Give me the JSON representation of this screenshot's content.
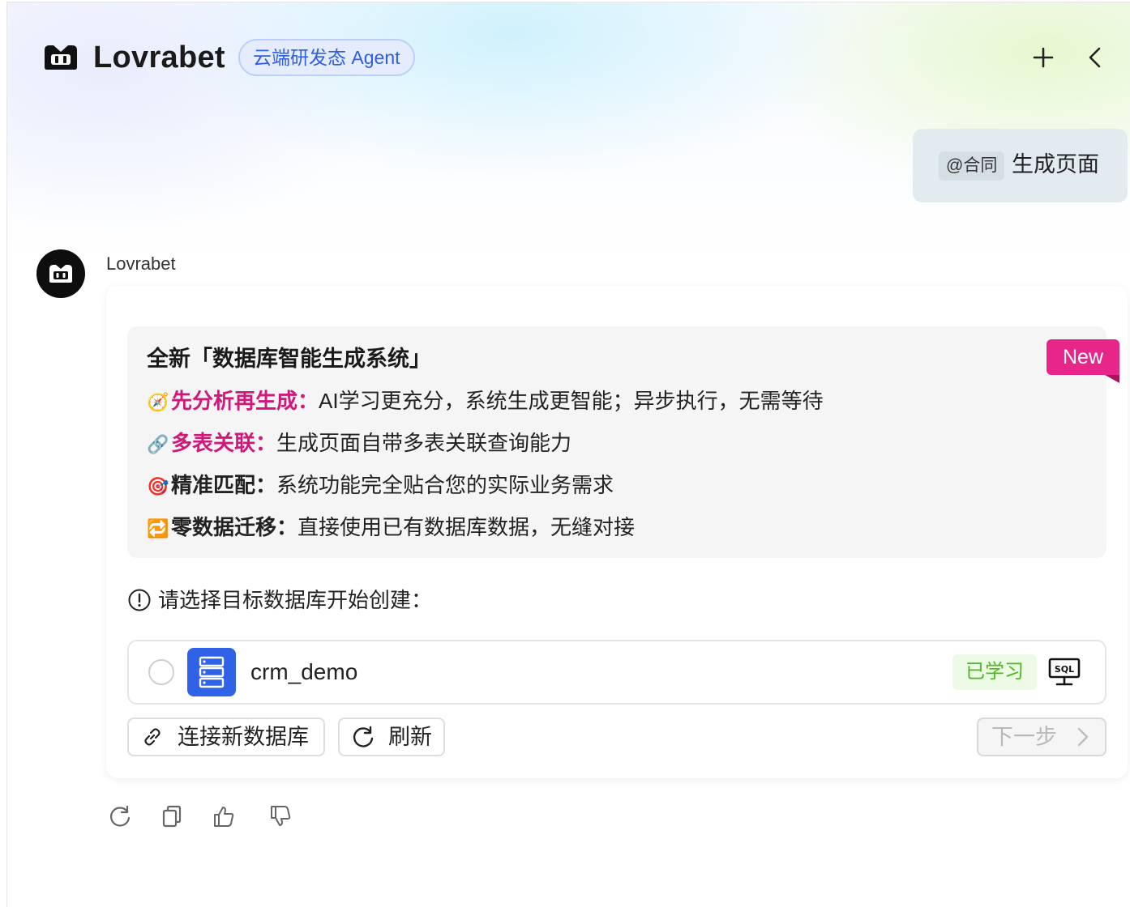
{
  "header": {
    "brand": "Lovrabet",
    "agent_pill": "云端研发态 Agent",
    "new_chat_icon": "plus-icon",
    "collapse_icon": "chevron-left-icon"
  },
  "user_message": {
    "mention": "@合同",
    "text": "生成页面"
  },
  "bot": {
    "name": "Lovrabet",
    "promo": {
      "title": "全新「数据库智能生成系统」",
      "badge": "New",
      "features": [
        {
          "emoji": "🧭",
          "key": "先分析再生成：",
          "text": "AI学习更充分，系统生成更智能；异步执行，无需等待",
          "highlight": true
        },
        {
          "emoji": "🔗",
          "key": "多表关联：",
          "text": "生成页面自带多表关联查询能力",
          "highlight": true
        },
        {
          "emoji": "🎯",
          "key": "精准匹配：",
          "text": "系统功能完全贴合您的实际业务需求",
          "highlight": false
        },
        {
          "emoji": "🔁",
          "key": "零数据迁移：",
          "text": "直接使用已有数据库数据，无缝对接",
          "highlight": false
        }
      ]
    },
    "hint": "请选择目标数据库开始创建：",
    "databases": [
      {
        "name": "crm_demo",
        "status": "已学习",
        "selected": false
      }
    ],
    "buttons": {
      "connect": "连接新数据库",
      "refresh": "刷新",
      "next": "下一步"
    },
    "actions": [
      "refresh-icon",
      "copy-icon",
      "thumbs-up-icon",
      "thumbs-down-icon"
    ]
  },
  "colors": {
    "accent_blue": "#2f62e6",
    "pill_text": "#2f5ee0",
    "highlight_pink": "#d0177a",
    "badge_pink": "#e8268a",
    "learned_green": "#4cba1e"
  }
}
